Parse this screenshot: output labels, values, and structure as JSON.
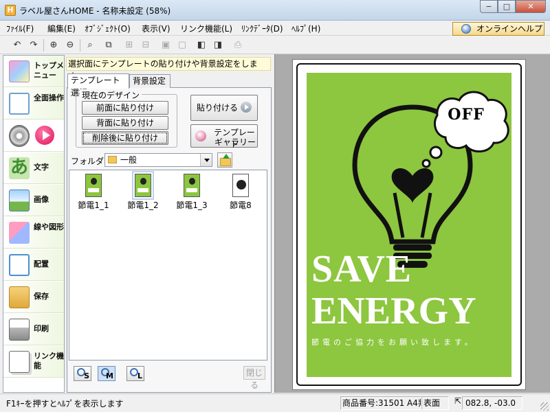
{
  "window": {
    "app_icon": "H",
    "title": "ラベル屋さんHOME - 名称未設定 (58%)",
    "controls": {
      "minimize": "−",
      "maximize": "□",
      "close": "✕"
    }
  },
  "menu": {
    "items": [
      "ﾌｧｲﾙ(F)",
      "編集(E)",
      "ｵﾌﾞｼﾞｪｸﾄ(O)",
      "表示(V)",
      "リンク機能(L)",
      "ﾘﾝｸﾃﾞｰﾀ(D)",
      "ﾍﾙﾌﾟ(H)"
    ],
    "help_button": "オンラインヘルプ"
  },
  "toolbar": {
    "icons": [
      "undo-icon",
      "redo-icon",
      "zoom-in-icon",
      "zoom-out-icon",
      "zoom-fit-icon",
      "group-icon",
      "align-icon",
      "distribute-icon",
      "lock-icon",
      "unlock-icon",
      "front-back-icon",
      "layout-icon",
      "print-preview-icon"
    ]
  },
  "nav": {
    "items": [
      {
        "label": "トップメニュー",
        "icon": "home-icon"
      },
      {
        "label": "全面操作",
        "icon": "full-operation-icon"
      },
      {
        "label": "",
        "icon": "disc-play-icon"
      },
      {
        "label": "文字",
        "icon": "text-icon"
      },
      {
        "label": "画像",
        "icon": "image-icon"
      },
      {
        "label": "線や図形",
        "icon": "shapes-icon"
      },
      {
        "label": "配置",
        "icon": "layout-icon"
      },
      {
        "label": "保存",
        "icon": "save-folder-icon"
      },
      {
        "label": "印刷",
        "icon": "printer-icon"
      },
      {
        "label": "リンク機能",
        "icon": "link-icon"
      }
    ]
  },
  "panel": {
    "hint": "選択面にテンプレートの貼り付けや背景設定をします。",
    "tabs": [
      "テンプレート選択",
      "背景設定"
    ],
    "group_title": "現在のデザイン",
    "paste_front": "前面に貼り付け",
    "paste_back": "背面に貼り付け",
    "paste_after_delete": "削除後に貼り付け",
    "paste": "貼り付ける",
    "gallery_line1": "テンプレート",
    "gallery_line2": "ギャラリー",
    "folder_label": "フォルダ",
    "folder_value": "一般",
    "templates": [
      "節電1_1",
      "節電1_2",
      "節電1_3",
      "節電8"
    ],
    "selected_template": "節電1_2",
    "size_buttons": [
      "S",
      "M",
      "L"
    ],
    "close_button": "閉じる"
  },
  "preview": {
    "bubble_text": "OFF",
    "headline1": "SAVE",
    "headline2": "ENERGY",
    "subline": "節電のご協力をお願い致します。",
    "colors": {
      "poster_bg": "#8dc63f",
      "text": "#ffffff",
      "ink": "#111111"
    }
  },
  "status": {
    "message": "F1ｷｰを押すとﾍﾙﾌﾟを表示します",
    "product": "商品番号:31501 A4判",
    "side": "表面",
    "coords": "082.8, -03.0"
  }
}
